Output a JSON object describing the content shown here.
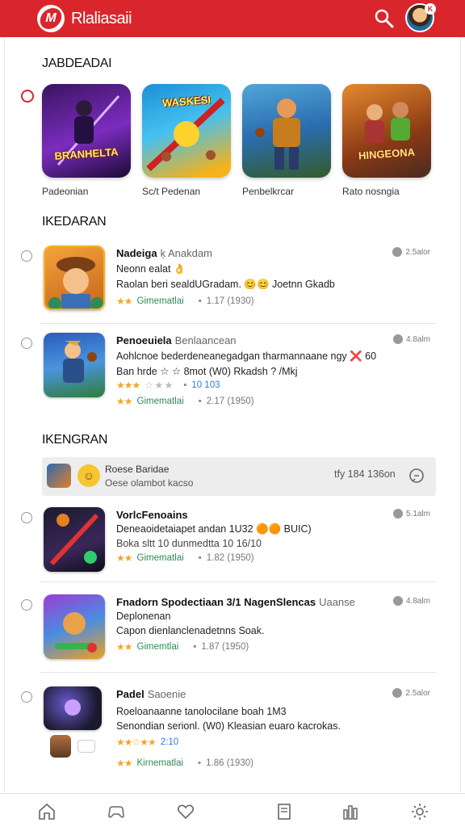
{
  "header": {
    "logo_letter": "M",
    "title": "Rlaliasaii",
    "avatar_badge": "K"
  },
  "sections": {
    "featured": "JABDEADAI",
    "second": "IKEDARAN",
    "third": "IKENGRAN"
  },
  "featured": [
    {
      "label": "Padeonian",
      "cap": "BRANHELTA"
    },
    {
      "label": "Sc/t Pedenan",
      "cap": "WASKESI"
    },
    {
      "label": "Penbelkrcar",
      "cap": ""
    },
    {
      "label": "Rato nosngia",
      "cap": "HINGEONA"
    }
  ],
  "list_a": [
    {
      "name": "Nadeiga",
      "sub": "ķ Anakdam",
      "line1": "Neonn ealat 👌",
      "line2": "Raolan beri sealdUGradam. 😊😊 Joetnn Gkadb",
      "stars": "★★",
      "genre": "Gimematlai",
      "ri": "▪",
      "count": "1.17 (1930)",
      "meta": "2.5alor"
    },
    {
      "name": "Penoeuiela",
      "sub": "Benlaancean",
      "line1": "Aohlcnoe bederdeneanegadgan tharmannaane ngy ❌ 60",
      "line2": "Ban hrde ☆ ☆ 8mot (W0) Rkadsh ? /Mkj",
      "stars_b": "★★★",
      "stars_b2": "☆ ★ ★",
      "rating_b": "10 103",
      "stars": "★★",
      "genre": "Gimematlai",
      "ri": "▪",
      "count": "2.17 (1950)",
      "meta": "4.8alm"
    }
  ],
  "promo": {
    "t1": "Roese Baridae",
    "t2": "Oese olambot kacso",
    "t3": "tfy 184 136on"
  },
  "list_b": [
    {
      "name": "VorlcFenoains",
      "sub": "",
      "line1": "Deneaoidetaiapet andan 1U32 🟠🟠 BUIC)",
      "line2": "Boka sltt 10 dunmedtta 10 16/10",
      "stars": "★★",
      "genre": "Gimematlai",
      "ri": "▪",
      "count": "1.82 (1950)",
      "meta": "5.1alm"
    },
    {
      "name": "Fnadorn Spodectiaan 3/1 NagenSlencas",
      "sub": "Uaanse",
      "line1": "Deplonenan",
      "line2": "Capon dienlanclenadetnns Soak.",
      "stars": "★★",
      "genre": "Gimemtlai",
      "ri": "▪",
      "count": "1.87 (1950)",
      "meta": "4.8alm"
    },
    {
      "name": "Padel",
      "sub": "Saoenie",
      "line1": "Roeloanaanne tanolocilane boah 1M3",
      "line2": "Senondian serionl. (W0) Kleasian euaro kacrokas.",
      "stars_c": "★★☆★★",
      "rating_c": "2:10",
      "stars": "★★",
      "genre": "Kirnematlai",
      "ri": "▪",
      "count": "1.86 (1930)",
      "meta": "2.5alor"
    }
  ],
  "nav": [
    "home-icon",
    "gamepad-icon",
    "heart-icon",
    "document-icon",
    "stats-icon",
    "gear-icon"
  ]
}
